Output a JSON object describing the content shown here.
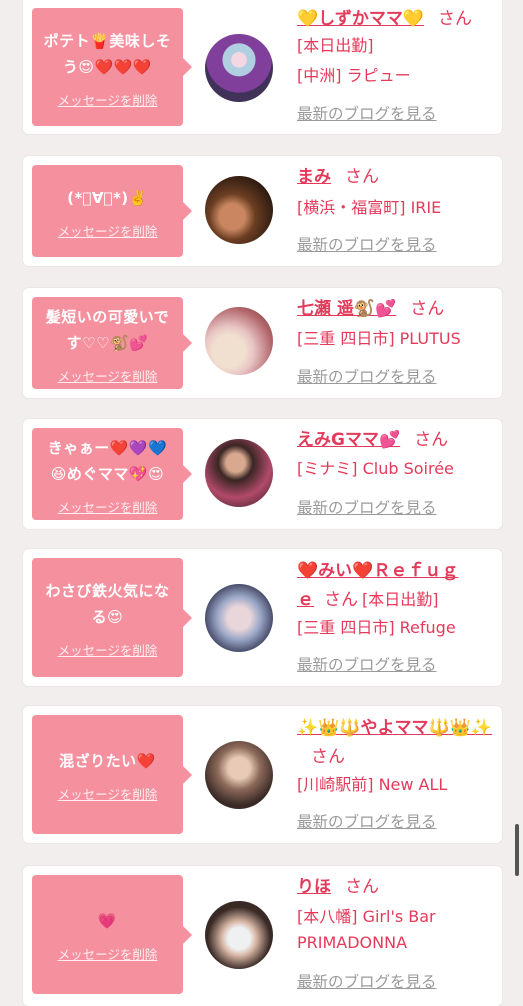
{
  "common": {
    "delete_label": "メッセージを削除",
    "blog_link": "最新のブログを見る",
    "honorific": "さん"
  },
  "colors": {
    "bubble": "#f5909f",
    "accent": "#e43a5a",
    "link_gray": "#9a9a9a",
    "background": "#f3eeee"
  },
  "cards": [
    {
      "message": "ポテト🍟美味しそう😍❤️❤️❤️",
      "name": "💛しずかママ💛",
      "lines": [
        "[本日出勤]",
        "[中洲] ラピュー"
      ]
    },
    {
      "message": "(*ﾟ∀ﾟ*)✌️",
      "name": "まみ",
      "lines": [
        "[横浜・福富町] IRIE"
      ]
    },
    {
      "message": "髪短いの可愛いです♡♡🐒💕",
      "name": "七瀬 遥🐒💕",
      "lines": [
        "[三重 四日市] PLUTUS"
      ]
    },
    {
      "message": "きゃぁー❤️💜💙😆めぐママ💖😍",
      "name": "えみGママ💕",
      "lines": [
        "[ミナミ] Club Soirée"
      ]
    },
    {
      "message": "わさび鉄火気になる😍",
      "name": "❤️みい❤️Ｒｅｆｕｇｅ",
      "lines": [
        "[本日出勤]",
        "[三重 四日市] Refuge"
      ]
    },
    {
      "message": "混ざりたい❤️",
      "name": "✨👑🔱やよママ🔱👑✨",
      "lines": [
        "[川崎駅前] New ALL"
      ]
    },
    {
      "message": "💗",
      "name": "りほ",
      "lines": [
        "[本八幡] Girl's Bar",
        "PRIMADONNA"
      ]
    }
  ]
}
